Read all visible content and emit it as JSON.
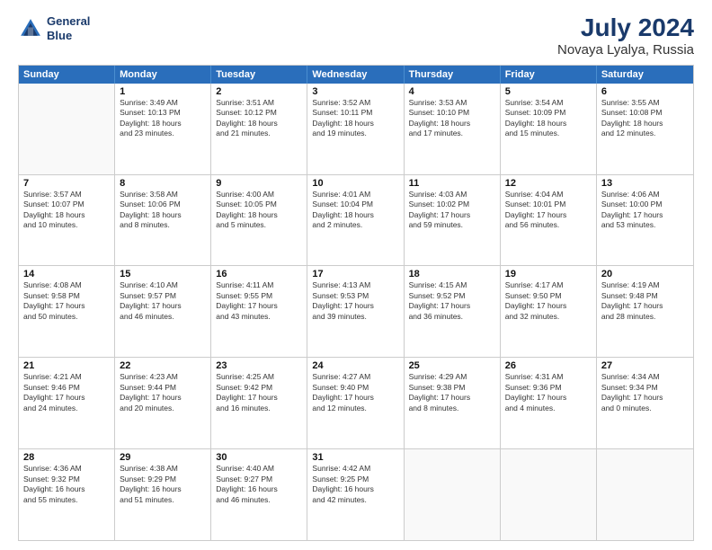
{
  "header": {
    "logo_line1": "General",
    "logo_line2": "Blue",
    "main_title": "July 2024",
    "sub_title": "Novaya Lyalya, Russia"
  },
  "days_of_week": [
    "Sunday",
    "Monday",
    "Tuesday",
    "Wednesday",
    "Thursday",
    "Friday",
    "Saturday"
  ],
  "weeks": [
    [
      {
        "day": "",
        "sunrise": "",
        "sunset": "",
        "daylight": ""
      },
      {
        "day": "1",
        "sunrise": "Sunrise: 3:49 AM",
        "sunset": "Sunset: 10:13 PM",
        "daylight": "Daylight: 18 hours and 23 minutes."
      },
      {
        "day": "2",
        "sunrise": "Sunrise: 3:51 AM",
        "sunset": "Sunset: 10:12 PM",
        "daylight": "Daylight: 18 hours and 21 minutes."
      },
      {
        "day": "3",
        "sunrise": "Sunrise: 3:52 AM",
        "sunset": "Sunset: 10:11 PM",
        "daylight": "Daylight: 18 hours and 19 minutes."
      },
      {
        "day": "4",
        "sunrise": "Sunrise: 3:53 AM",
        "sunset": "Sunset: 10:10 PM",
        "daylight": "Daylight: 18 hours and 17 minutes."
      },
      {
        "day": "5",
        "sunrise": "Sunrise: 3:54 AM",
        "sunset": "Sunset: 10:09 PM",
        "daylight": "Daylight: 18 hours and 15 minutes."
      },
      {
        "day": "6",
        "sunrise": "Sunrise: 3:55 AM",
        "sunset": "Sunset: 10:08 PM",
        "daylight": "Daylight: 18 hours and 12 minutes."
      }
    ],
    [
      {
        "day": "7",
        "sunrise": "Sunrise: 3:57 AM",
        "sunset": "Sunset: 10:07 PM",
        "daylight": "Daylight: 18 hours and 10 minutes."
      },
      {
        "day": "8",
        "sunrise": "Sunrise: 3:58 AM",
        "sunset": "Sunset: 10:06 PM",
        "daylight": "Daylight: 18 hours and 8 minutes."
      },
      {
        "day": "9",
        "sunrise": "Sunrise: 4:00 AM",
        "sunset": "Sunset: 10:05 PM",
        "daylight": "Daylight: 18 hours and 5 minutes."
      },
      {
        "day": "10",
        "sunrise": "Sunrise: 4:01 AM",
        "sunset": "Sunset: 10:04 PM",
        "daylight": "Daylight: 18 hours and 2 minutes."
      },
      {
        "day": "11",
        "sunrise": "Sunrise: 4:03 AM",
        "sunset": "Sunset: 10:02 PM",
        "daylight": "Daylight: 17 hours and 59 minutes."
      },
      {
        "day": "12",
        "sunrise": "Sunrise: 4:04 AM",
        "sunset": "Sunset: 10:01 PM",
        "daylight": "Daylight: 17 hours and 56 minutes."
      },
      {
        "day": "13",
        "sunrise": "Sunrise: 4:06 AM",
        "sunset": "Sunset: 10:00 PM",
        "daylight": "Daylight: 17 hours and 53 minutes."
      }
    ],
    [
      {
        "day": "14",
        "sunrise": "Sunrise: 4:08 AM",
        "sunset": "Sunset: 9:58 PM",
        "daylight": "Daylight: 17 hours and 50 minutes."
      },
      {
        "day": "15",
        "sunrise": "Sunrise: 4:10 AM",
        "sunset": "Sunset: 9:57 PM",
        "daylight": "Daylight: 17 hours and 46 minutes."
      },
      {
        "day": "16",
        "sunrise": "Sunrise: 4:11 AM",
        "sunset": "Sunset: 9:55 PM",
        "daylight": "Daylight: 17 hours and 43 minutes."
      },
      {
        "day": "17",
        "sunrise": "Sunrise: 4:13 AM",
        "sunset": "Sunset: 9:53 PM",
        "daylight": "Daylight: 17 hours and 39 minutes."
      },
      {
        "day": "18",
        "sunrise": "Sunrise: 4:15 AM",
        "sunset": "Sunset: 9:52 PM",
        "daylight": "Daylight: 17 hours and 36 minutes."
      },
      {
        "day": "19",
        "sunrise": "Sunrise: 4:17 AM",
        "sunset": "Sunset: 9:50 PM",
        "daylight": "Daylight: 17 hours and 32 minutes."
      },
      {
        "day": "20",
        "sunrise": "Sunrise: 4:19 AM",
        "sunset": "Sunset: 9:48 PM",
        "daylight": "Daylight: 17 hours and 28 minutes."
      }
    ],
    [
      {
        "day": "21",
        "sunrise": "Sunrise: 4:21 AM",
        "sunset": "Sunset: 9:46 PM",
        "daylight": "Daylight: 17 hours and 24 minutes."
      },
      {
        "day": "22",
        "sunrise": "Sunrise: 4:23 AM",
        "sunset": "Sunset: 9:44 PM",
        "daylight": "Daylight: 17 hours and 20 minutes."
      },
      {
        "day": "23",
        "sunrise": "Sunrise: 4:25 AM",
        "sunset": "Sunset: 9:42 PM",
        "daylight": "Daylight: 17 hours and 16 minutes."
      },
      {
        "day": "24",
        "sunrise": "Sunrise: 4:27 AM",
        "sunset": "Sunset: 9:40 PM",
        "daylight": "Daylight: 17 hours and 12 minutes."
      },
      {
        "day": "25",
        "sunrise": "Sunrise: 4:29 AM",
        "sunset": "Sunset: 9:38 PM",
        "daylight": "Daylight: 17 hours and 8 minutes."
      },
      {
        "day": "26",
        "sunrise": "Sunrise: 4:31 AM",
        "sunset": "Sunset: 9:36 PM",
        "daylight": "Daylight: 17 hours and 4 minutes."
      },
      {
        "day": "27",
        "sunrise": "Sunrise: 4:34 AM",
        "sunset": "Sunset: 9:34 PM",
        "daylight": "Daylight: 17 hours and 0 minutes."
      }
    ],
    [
      {
        "day": "28",
        "sunrise": "Sunrise: 4:36 AM",
        "sunset": "Sunset: 9:32 PM",
        "daylight": "Daylight: 16 hours and 55 minutes."
      },
      {
        "day": "29",
        "sunrise": "Sunrise: 4:38 AM",
        "sunset": "Sunset: 9:29 PM",
        "daylight": "Daylight: 16 hours and 51 minutes."
      },
      {
        "day": "30",
        "sunrise": "Sunrise: 4:40 AM",
        "sunset": "Sunset: 9:27 PM",
        "daylight": "Daylight: 16 hours and 46 minutes."
      },
      {
        "day": "31",
        "sunrise": "Sunrise: 4:42 AM",
        "sunset": "Sunset: 9:25 PM",
        "daylight": "Daylight: 16 hours and 42 minutes."
      },
      {
        "day": "",
        "sunrise": "",
        "sunset": "",
        "daylight": ""
      },
      {
        "day": "",
        "sunrise": "",
        "sunset": "",
        "daylight": ""
      },
      {
        "day": "",
        "sunrise": "",
        "sunset": "",
        "daylight": ""
      }
    ]
  ]
}
